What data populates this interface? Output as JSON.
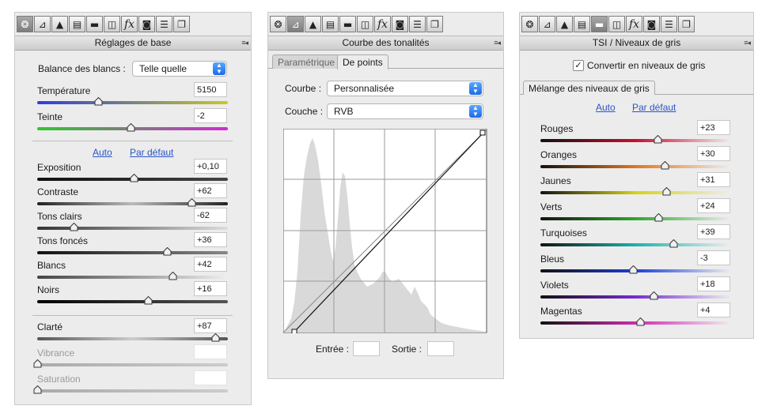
{
  "toolbar_icons": [
    "aperture-icon",
    "curve-icon",
    "mountain-icon",
    "detail-icon",
    "grayscale-icon",
    "split-icon",
    "fx-icon",
    "camera-icon",
    "sliders-icon",
    "presets-icon"
  ],
  "fx_label": "fx",
  "panel_menu_glyph": "≡◂",
  "basic": {
    "title": "Réglages de base",
    "wb_label": "Balance des blancs :",
    "wb_value": "Telle quelle",
    "temperature": {
      "label": "Température",
      "value": "5150",
      "pos": 0.32
    },
    "tint": {
      "label": "Teinte",
      "value": "-2",
      "pos": 0.49
    },
    "auto": "Auto",
    "default": "Par défaut",
    "sliders": [
      {
        "label": "Exposition",
        "value": "+0,10",
        "pos": 0.505
      },
      {
        "label": "Contraste",
        "value": "+62",
        "pos": 0.81
      },
      {
        "label": "Tons clairs",
        "value": "-62",
        "pos": 0.19
      },
      {
        "label": "Tons foncés",
        "value": "+36",
        "pos": 0.68
      },
      {
        "label": "Blancs",
        "value": "+42",
        "pos": 0.71
      },
      {
        "label": "Noirs",
        "value": "+16",
        "pos": 0.58
      }
    ],
    "clarity": {
      "label": "Clarté",
      "value": "+87",
      "pos": 0.935
    },
    "vibrance": {
      "label": "Vibrance",
      "value": "",
      "pos": 0.0
    },
    "saturation": {
      "label": "Saturation",
      "value": "",
      "pos": 0.0
    }
  },
  "curve": {
    "title": "Courbe des tonalités",
    "tab_parametric": "Paramétrique",
    "tab_points": "De points",
    "curve_label": "Courbe :",
    "curve_value": "Personnalisée",
    "channel_label": "Couche :",
    "channel_value": "RVB",
    "input_label": "Entrée :",
    "output_label": "Sortie :",
    "input_value": "",
    "output_value": ""
  },
  "grayscale": {
    "title": "TSI / Niveaux de gris",
    "convert_label": "Convertir en niveaux de gris",
    "convert_checked": "✓",
    "mix_tab": "Mélange des niveaux de gris",
    "auto": "Auto",
    "default": "Par défaut",
    "sliders": [
      {
        "label": "Rouges",
        "value": "+23",
        "pos": 0.61,
        "color": "#c8102e"
      },
      {
        "label": "Oranges",
        "value": "+30",
        "pos": 0.65,
        "color": "#e07820"
      },
      {
        "label": "Jaunes",
        "value": "+31",
        "pos": 0.655,
        "color": "#d6d21a"
      },
      {
        "label": "Verts",
        "value": "+24",
        "pos": 0.615,
        "color": "#2ea82e"
      },
      {
        "label": "Turquoises",
        "value": "+39",
        "pos": 0.695,
        "color": "#20b2aa"
      },
      {
        "label": "Bleus",
        "value": "-3",
        "pos": 0.485,
        "color": "#1c3fd6"
      },
      {
        "label": "Violets",
        "value": "+18",
        "pos": 0.59,
        "color": "#7a2ad6"
      },
      {
        "label": "Magentas",
        "value": "+4",
        "pos": 0.52,
        "color": "#d22ab4"
      }
    ]
  }
}
